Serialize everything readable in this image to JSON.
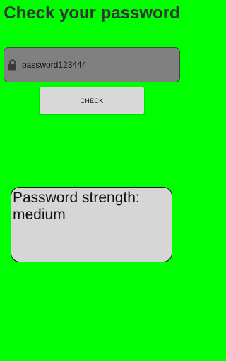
{
  "header": {
    "title": "Check your password"
  },
  "password_field": {
    "value": "password123444",
    "icon": "lock-icon"
  },
  "check_button": {
    "label": "CHECK"
  },
  "result": {
    "text": "Password strength: medium"
  },
  "colors": {
    "background": "#00ff00",
    "title_text": "#333333",
    "field_background": "#808080",
    "button_background": "#d9d9d9",
    "result_background": "#d6d6d6"
  }
}
